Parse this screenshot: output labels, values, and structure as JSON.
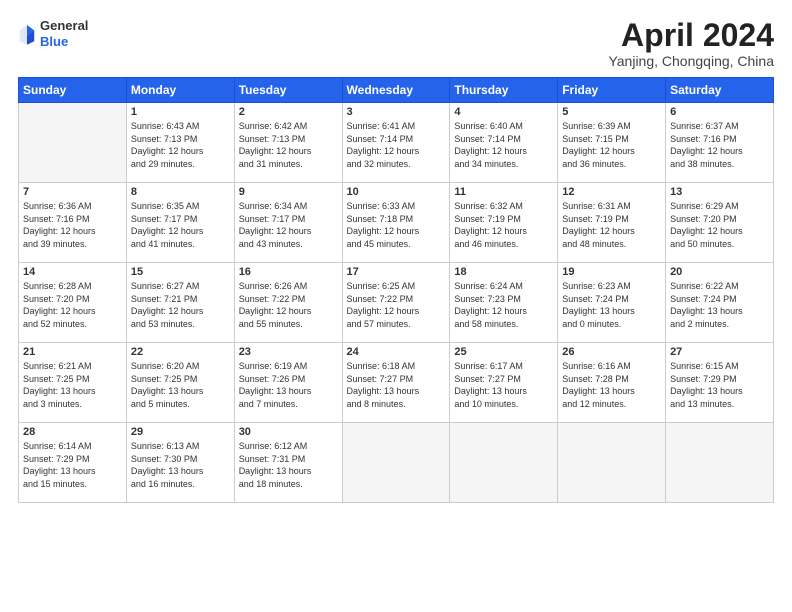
{
  "logo": {
    "general": "General",
    "blue": "Blue"
  },
  "title": {
    "month": "April 2024",
    "location": "Yanjing, Chongqing, China"
  },
  "days_header": [
    "Sunday",
    "Monday",
    "Tuesday",
    "Wednesday",
    "Thursday",
    "Friday",
    "Saturday"
  ],
  "weeks": [
    [
      {
        "day": "",
        "empty": true
      },
      {
        "day": "1",
        "sunrise": "Sunrise: 6:43 AM",
        "sunset": "Sunset: 7:13 PM",
        "daylight": "Daylight: 12 hours and 29 minutes."
      },
      {
        "day": "2",
        "sunrise": "Sunrise: 6:42 AM",
        "sunset": "Sunset: 7:13 PM",
        "daylight": "Daylight: 12 hours and 31 minutes."
      },
      {
        "day": "3",
        "sunrise": "Sunrise: 6:41 AM",
        "sunset": "Sunset: 7:14 PM",
        "daylight": "Daylight: 12 hours and 32 minutes."
      },
      {
        "day": "4",
        "sunrise": "Sunrise: 6:40 AM",
        "sunset": "Sunset: 7:14 PM",
        "daylight": "Daylight: 12 hours and 34 minutes."
      },
      {
        "day": "5",
        "sunrise": "Sunrise: 6:39 AM",
        "sunset": "Sunset: 7:15 PM",
        "daylight": "Daylight: 12 hours and 36 minutes."
      },
      {
        "day": "6",
        "sunrise": "Sunrise: 6:37 AM",
        "sunset": "Sunset: 7:16 PM",
        "daylight": "Daylight: 12 hours and 38 minutes."
      }
    ],
    [
      {
        "day": "7",
        "sunrise": "Sunrise: 6:36 AM",
        "sunset": "Sunset: 7:16 PM",
        "daylight": "Daylight: 12 hours and 39 minutes."
      },
      {
        "day": "8",
        "sunrise": "Sunrise: 6:35 AM",
        "sunset": "Sunset: 7:17 PM",
        "daylight": "Daylight: 12 hours and 41 minutes."
      },
      {
        "day": "9",
        "sunrise": "Sunrise: 6:34 AM",
        "sunset": "Sunset: 7:17 PM",
        "daylight": "Daylight: 12 hours and 43 minutes."
      },
      {
        "day": "10",
        "sunrise": "Sunrise: 6:33 AM",
        "sunset": "Sunset: 7:18 PM",
        "daylight": "Daylight: 12 hours and 45 minutes."
      },
      {
        "day": "11",
        "sunrise": "Sunrise: 6:32 AM",
        "sunset": "Sunset: 7:19 PM",
        "daylight": "Daylight: 12 hours and 46 minutes."
      },
      {
        "day": "12",
        "sunrise": "Sunrise: 6:31 AM",
        "sunset": "Sunset: 7:19 PM",
        "daylight": "Daylight: 12 hours and 48 minutes."
      },
      {
        "day": "13",
        "sunrise": "Sunrise: 6:29 AM",
        "sunset": "Sunset: 7:20 PM",
        "daylight": "Daylight: 12 hours and 50 minutes."
      }
    ],
    [
      {
        "day": "14",
        "sunrise": "Sunrise: 6:28 AM",
        "sunset": "Sunset: 7:20 PM",
        "daylight": "Daylight: 12 hours and 52 minutes."
      },
      {
        "day": "15",
        "sunrise": "Sunrise: 6:27 AM",
        "sunset": "Sunset: 7:21 PM",
        "daylight": "Daylight: 12 hours and 53 minutes."
      },
      {
        "day": "16",
        "sunrise": "Sunrise: 6:26 AM",
        "sunset": "Sunset: 7:22 PM",
        "daylight": "Daylight: 12 hours and 55 minutes."
      },
      {
        "day": "17",
        "sunrise": "Sunrise: 6:25 AM",
        "sunset": "Sunset: 7:22 PM",
        "daylight": "Daylight: 12 hours and 57 minutes."
      },
      {
        "day": "18",
        "sunrise": "Sunrise: 6:24 AM",
        "sunset": "Sunset: 7:23 PM",
        "daylight": "Daylight: 12 hours and 58 minutes."
      },
      {
        "day": "19",
        "sunrise": "Sunrise: 6:23 AM",
        "sunset": "Sunset: 7:24 PM",
        "daylight": "Daylight: 13 hours and 0 minutes."
      },
      {
        "day": "20",
        "sunrise": "Sunrise: 6:22 AM",
        "sunset": "Sunset: 7:24 PM",
        "daylight": "Daylight: 13 hours and 2 minutes."
      }
    ],
    [
      {
        "day": "21",
        "sunrise": "Sunrise: 6:21 AM",
        "sunset": "Sunset: 7:25 PM",
        "daylight": "Daylight: 13 hours and 3 minutes."
      },
      {
        "day": "22",
        "sunrise": "Sunrise: 6:20 AM",
        "sunset": "Sunset: 7:25 PM",
        "daylight": "Daylight: 13 hours and 5 minutes."
      },
      {
        "day": "23",
        "sunrise": "Sunrise: 6:19 AM",
        "sunset": "Sunset: 7:26 PM",
        "daylight": "Daylight: 13 hours and 7 minutes."
      },
      {
        "day": "24",
        "sunrise": "Sunrise: 6:18 AM",
        "sunset": "Sunset: 7:27 PM",
        "daylight": "Daylight: 13 hours and 8 minutes."
      },
      {
        "day": "25",
        "sunrise": "Sunrise: 6:17 AM",
        "sunset": "Sunset: 7:27 PM",
        "daylight": "Daylight: 13 hours and 10 minutes."
      },
      {
        "day": "26",
        "sunrise": "Sunrise: 6:16 AM",
        "sunset": "Sunset: 7:28 PM",
        "daylight": "Daylight: 13 hours and 12 minutes."
      },
      {
        "day": "27",
        "sunrise": "Sunrise: 6:15 AM",
        "sunset": "Sunset: 7:29 PM",
        "daylight": "Daylight: 13 hours and 13 minutes."
      }
    ],
    [
      {
        "day": "28",
        "sunrise": "Sunrise: 6:14 AM",
        "sunset": "Sunset: 7:29 PM",
        "daylight": "Daylight: 13 hours and 15 minutes."
      },
      {
        "day": "29",
        "sunrise": "Sunrise: 6:13 AM",
        "sunset": "Sunset: 7:30 PM",
        "daylight": "Daylight: 13 hours and 16 minutes."
      },
      {
        "day": "30",
        "sunrise": "Sunrise: 6:12 AM",
        "sunset": "Sunset: 7:31 PM",
        "daylight": "Daylight: 13 hours and 18 minutes."
      },
      {
        "day": "",
        "empty": true
      },
      {
        "day": "",
        "empty": true
      },
      {
        "day": "",
        "empty": true
      },
      {
        "day": "",
        "empty": true
      }
    ]
  ]
}
